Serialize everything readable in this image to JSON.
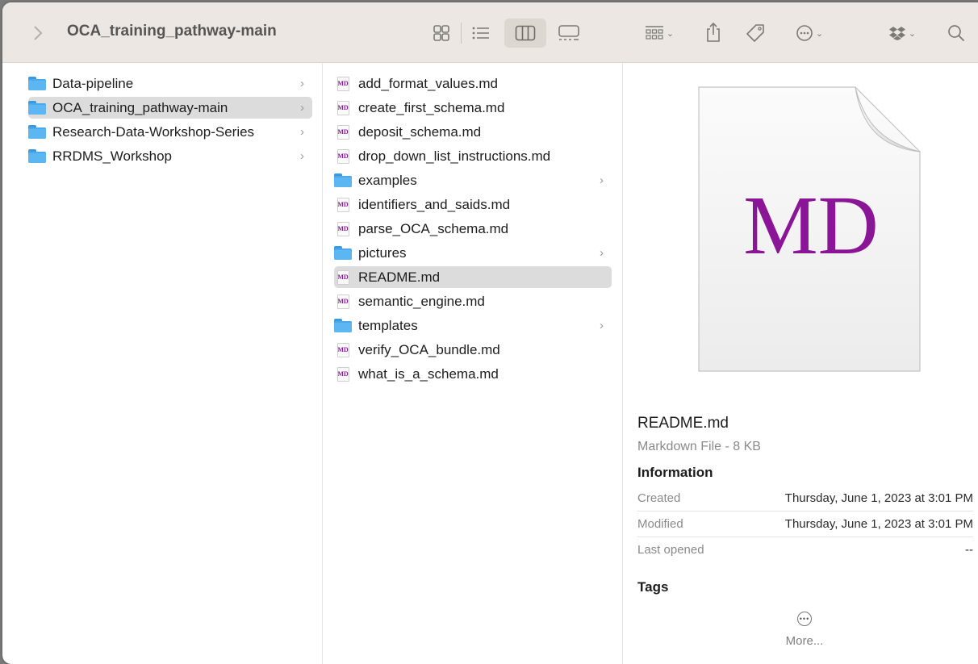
{
  "toolbar": {
    "title": "OCA_training_pathway-main",
    "view_icons": [
      "icon-view-icon",
      "list-view-icon",
      "column-view-icon",
      "gallery-view-icon"
    ],
    "active_view": "column-view-icon"
  },
  "sidebar_column": {
    "items": [
      {
        "label": "Data-pipeline",
        "type": "folder",
        "selected": false
      },
      {
        "label": "OCA_training_pathway-main",
        "type": "folder",
        "selected": true
      },
      {
        "label": "Research-Data-Workshop-Series",
        "type": "folder",
        "selected": false
      },
      {
        "label": "RRDMS_Workshop",
        "type": "folder",
        "selected": false
      }
    ]
  },
  "files_column": {
    "items": [
      {
        "label": "add_format_values.md",
        "type": "md"
      },
      {
        "label": "create_first_schema.md",
        "type": "md"
      },
      {
        "label": "deposit_schema.md",
        "type": "md"
      },
      {
        "label": "drop_down_list_instructions.md",
        "type": "md"
      },
      {
        "label": "examples",
        "type": "folder"
      },
      {
        "label": "identifiers_and_saids.md",
        "type": "md"
      },
      {
        "label": "parse_OCA_schema.md",
        "type": "md"
      },
      {
        "label": "pictures",
        "type": "folder"
      },
      {
        "label": "README.md",
        "type": "md",
        "selected": true
      },
      {
        "label": "semantic_engine.md",
        "type": "md"
      },
      {
        "label": "templates",
        "type": "folder"
      },
      {
        "label": "verify_OCA_bundle.md",
        "type": "md"
      },
      {
        "label": "what_is_a_schema.md",
        "type": "md"
      }
    ],
    "md_badge": "MD"
  },
  "preview": {
    "icon_text": "MD",
    "file_name": "README.md",
    "file_kind": "Markdown File - 8 KB",
    "info_heading": "Information",
    "created_label": "Created",
    "created_value": "Thursday, June 1, 2023 at 3:01 PM",
    "modified_label": "Modified",
    "modified_value": "Thursday, June 1, 2023 at 3:01 PM",
    "last_opened_label": "Last opened",
    "last_opened_value": "--",
    "tags_heading": "Tags",
    "more_label": "More..."
  },
  "colors": {
    "toolbar_bg": "#ece7e2",
    "folder_blue": "#4aa9ec",
    "md_purple": "#8a1596",
    "selection_gray": "#dcdcdc"
  }
}
